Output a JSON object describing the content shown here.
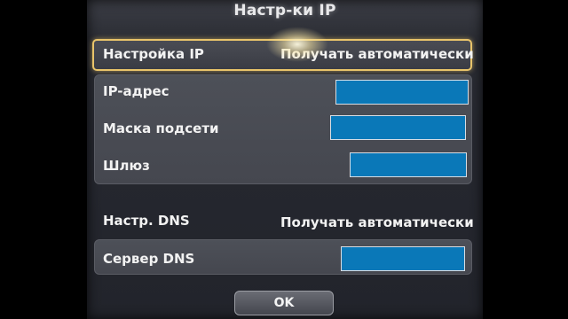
{
  "dialog": {
    "title": "Настр-ки IP"
  },
  "ip_settings": {
    "label": "Настройка IP",
    "value": "Получать автоматически"
  },
  "fields": {
    "ip_address_label": "IP-адрес",
    "subnet_mask_label": "Маска подсети",
    "gateway_label": "Шлюз"
  },
  "dns": {
    "label": "Настр. DNS",
    "value": "Получать автоматически",
    "server_label": "Сервер DNS"
  },
  "buttons": {
    "ok_label": "OK"
  },
  "colors": {
    "field_fill": "#0a78b8",
    "selection_border": "#e9c46a",
    "dialog_bg": "#262830"
  }
}
